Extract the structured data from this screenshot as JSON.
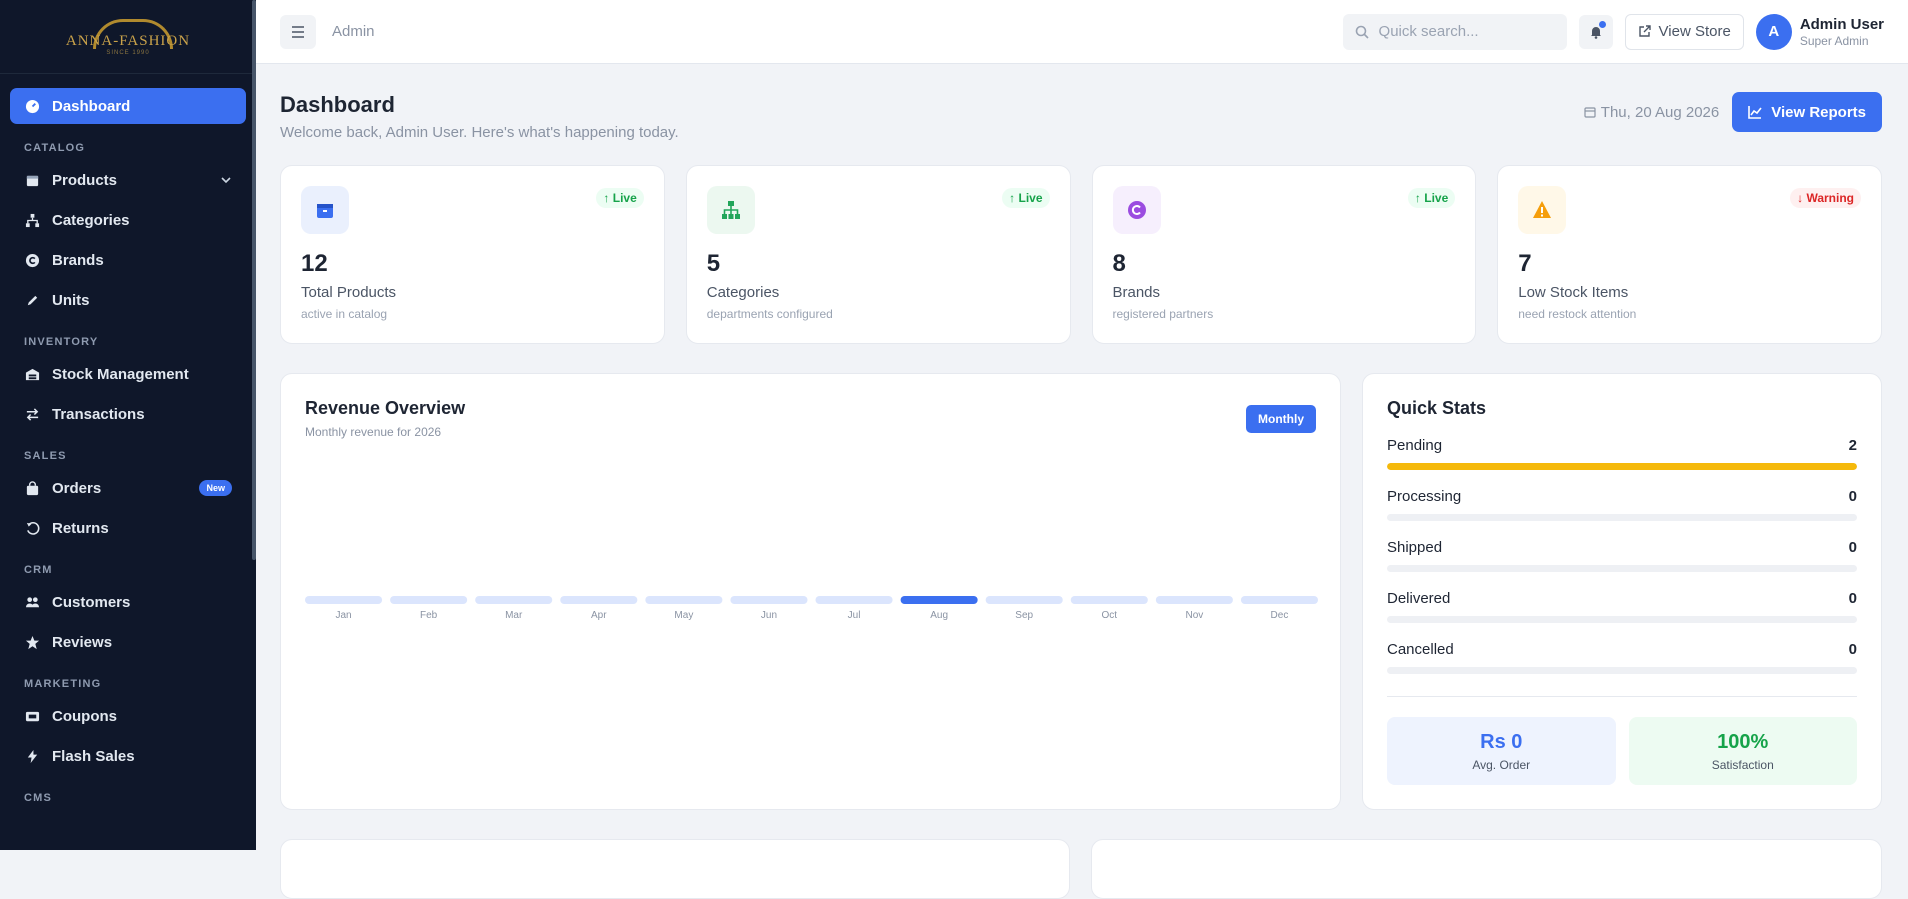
{
  "sidebar": {
    "logo_text": "ANNA-FASHION",
    "logo_sub": "SINCE 1990",
    "items": {
      "dashboard": "Dashboard",
      "catalog": "CATALOG",
      "products": "Products",
      "categories": "Categories",
      "brands": "Brands",
      "units": "Units",
      "inventory": "INVENTORY",
      "stock": "Stock Management",
      "transactions": "Transactions",
      "sales": "SALES",
      "orders": "Orders",
      "orders_badge": "New",
      "returns": "Returns",
      "crm": "CRM",
      "customers": "Customers",
      "reviews": "Reviews",
      "marketing": "MARKETING",
      "coupons": "Coupons",
      "flash": "Flash Sales",
      "cms": "CMS"
    }
  },
  "topbar": {
    "breadcrumb": "Admin",
    "search_placeholder": "Quick search...",
    "view_store": "View Store",
    "avatar_letter": "A",
    "user_name": "Admin User",
    "user_role": "Super Admin"
  },
  "header": {
    "title": "Dashboard",
    "subtitle": "Welcome back, Admin User. Here's what's happening today.",
    "date": "Thu, 20 Aug 2026",
    "reports_button": "View Reports"
  },
  "cards": [
    {
      "value": "12",
      "label": "Total Products",
      "sub": "active in catalog",
      "badge": "Live",
      "icon": "box-icon"
    },
    {
      "value": "5",
      "label": "Categories",
      "sub": "departments configured",
      "badge": "Live",
      "icon": "sitemap-icon"
    },
    {
      "value": "8",
      "label": "Brands",
      "sub": "registered partners",
      "badge": "Live",
      "icon": "copyright-icon"
    },
    {
      "value": "7",
      "label": "Low Stock Items",
      "sub": "need restock attention",
      "badge": "Warning",
      "icon": "warning-icon"
    }
  ],
  "revenue": {
    "title": "Revenue Overview",
    "subtitle": "Monthly revenue for 2026",
    "period_button": "Monthly"
  },
  "chart_data": {
    "type": "bar",
    "categories": [
      "Jan",
      "Feb",
      "Mar",
      "Apr",
      "May",
      "Jun",
      "Jul",
      "Aug",
      "Sep",
      "Oct",
      "Nov",
      "Dec"
    ],
    "values": [
      0,
      0,
      0,
      0,
      0,
      0,
      0,
      0,
      0,
      0,
      0,
      0
    ],
    "highlight": "Aug",
    "colors": {
      "bar": "#dbe5fd",
      "highlight": "#3b6ff0"
    }
  },
  "quick_stats": {
    "title": "Quick Stats",
    "rows": [
      {
        "label": "Pending",
        "value": "2",
        "fill": 1.0
      },
      {
        "label": "Processing",
        "value": "0",
        "fill": 0
      },
      {
        "label": "Shipped",
        "value": "0",
        "fill": 0
      },
      {
        "label": "Delivered",
        "value": "0",
        "fill": 0
      },
      {
        "label": "Cancelled",
        "value": "0",
        "fill": 0
      }
    ],
    "avg_order_value": "Rs 0",
    "avg_order_label": "Avg. Order",
    "satisfaction_value": "100%",
    "satisfaction_label": "Satisfaction"
  },
  "colors": {
    "accent": "#3b6ff0",
    "sidebar_bg": "#0f172a",
    "live_green": "#16a34a",
    "warning_red": "#dc2626",
    "pending_bar": "#f5b90b"
  }
}
